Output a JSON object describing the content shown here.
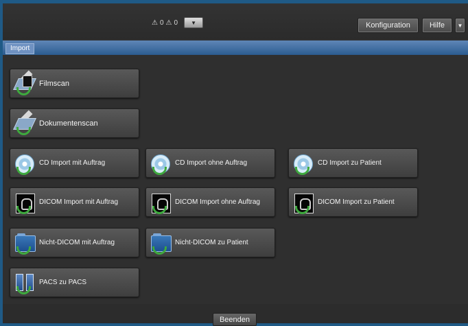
{
  "topbar": {
    "alert_count_1": "0",
    "alert_count_2": "0",
    "dropdown_symbol": "▼",
    "configuration_label": "Konfiguration",
    "help_label": "Hilfe",
    "menu_symbol": "▼"
  },
  "section": {
    "tab_label": "Import"
  },
  "actions": {
    "filmscan": "Filmscan",
    "documentscan": "Dokumentenscan",
    "cd_with_order": "CD Import mit Auftrag",
    "cd_without_order": "CD Import ohne Auftrag",
    "cd_to_patient": "CD Import zu Patient",
    "dicom_with_order": "DICOM Import mit Auftrag",
    "dicom_without_order": "DICOM Import ohne Auftrag",
    "dicom_to_patient": "DICOM Import zu Patient",
    "non_dicom_with_order": "Nicht-DICOM mit Auftrag",
    "non_dicom_to_patient": "Nicht-DICOM zu Patient",
    "pacs_to_pacs": "PACS zu PACS"
  },
  "footer": {
    "finish_label": "Beenden"
  },
  "colors": {
    "outer_background": "#1f5a86",
    "panel_background": "#2f2f2f",
    "header_blue": "#2b5c90",
    "import_tab_blue": "#6f92c2",
    "success_arrow": "#3ea93e"
  },
  "icons": {
    "alert_icon": "warning-triangle",
    "scanner_icon": "scanner",
    "cd_icon": "compact-disc",
    "dicom_icon": "lungs-image",
    "folder_icon": "folder",
    "pacs_icon": "server-stack"
  }
}
